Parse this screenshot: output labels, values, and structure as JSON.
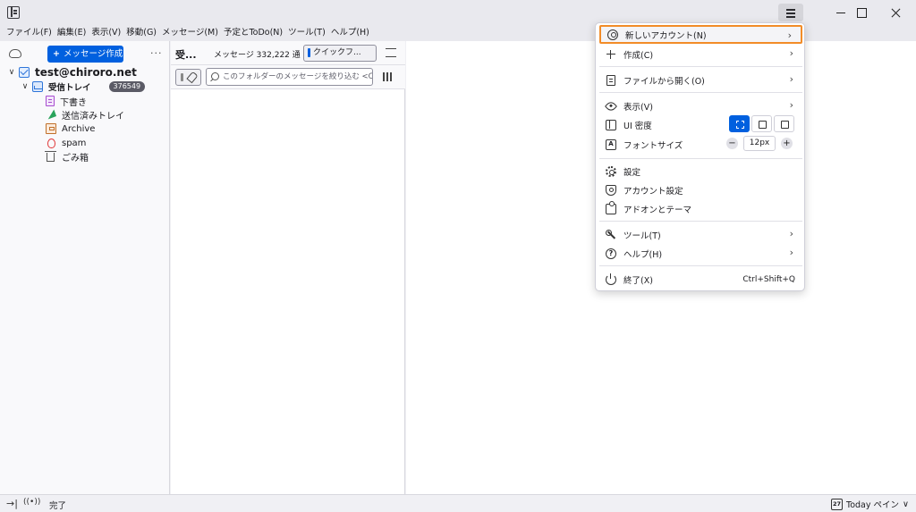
{
  "menubar": {
    "items": [
      "ファイル(F)",
      "編集(E)",
      "表示(V)",
      "移動(G)",
      "メッセージ(M)",
      "予定とToDo(N)",
      "ツール(T)",
      "ヘルプ(H)"
    ]
  },
  "folder_pane": {
    "compose_label": "メッセージ作成",
    "more_label": "···",
    "account": "test@chiroro.net",
    "inbox": "受信トレイ",
    "inbox_count": "376549",
    "folders": [
      "下書き",
      "送信済みトレイ",
      "Archive",
      "spam",
      "ごみ箱"
    ]
  },
  "thread_pane": {
    "folder_name": "受...",
    "message_count": "メッセージ 332,222 通",
    "quick_filter_label": "クイックフ...",
    "search_placeholder": "このフォルダーのメッセージを絞り込む <C"
  },
  "statusbar": {
    "status_text": "完了",
    "today_pane_label": "Today ペイン",
    "calendar_day": "27"
  },
  "app_menu": {
    "new_account": "新しいアカウント(N)",
    "create": "作成(C)",
    "open_file": "ファイルから開く(O)",
    "view": "表示(V)",
    "ui_density": "UI 密度",
    "font_size": "フォントサイズ",
    "font_size_value": "12px",
    "settings": "設定",
    "account_settings": "アカウント設定",
    "addons": "アドオンとテーマ",
    "tools": "ツール(T)",
    "help": "ヘルプ(H)",
    "quit": "終了(X)",
    "quit_shortcut": "Ctrl+Shift+Q"
  },
  "colors": {
    "accent": "#0060df",
    "highlight_border": "#f28c28",
    "badge": "#5b5b66"
  }
}
